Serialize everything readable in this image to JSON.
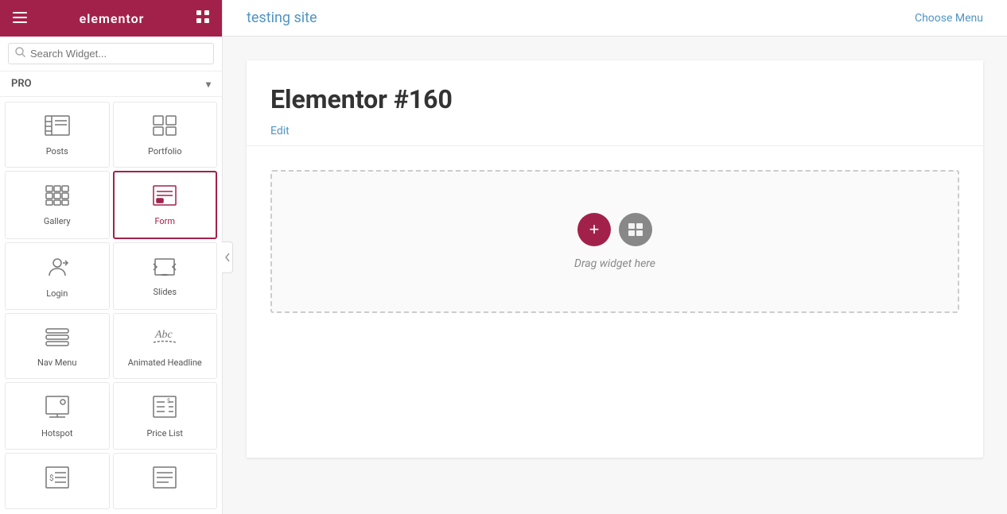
{
  "sidebar": {
    "header": {
      "brand": "elementor",
      "hamburger": "☰",
      "grid": "⊞"
    },
    "search": {
      "placeholder": "Search Widget..."
    },
    "pro_filter": {
      "label": "PRO",
      "chevron": "▾"
    },
    "widgets": [
      {
        "id": "posts",
        "label": "Posts",
        "icon": "posts"
      },
      {
        "id": "portfolio",
        "label": "Portfolio",
        "icon": "portfolio"
      },
      {
        "id": "gallery",
        "label": "Gallery",
        "icon": "gallery"
      },
      {
        "id": "form",
        "label": "Form",
        "icon": "form",
        "active": true
      },
      {
        "id": "login",
        "label": "Login",
        "icon": "login"
      },
      {
        "id": "slides",
        "label": "Slides",
        "icon": "slides"
      },
      {
        "id": "nav-menu",
        "label": "Nav Menu",
        "icon": "navmenu"
      },
      {
        "id": "animated-headline",
        "label": "Animated Headline",
        "icon": "animated"
      },
      {
        "id": "hotspot",
        "label": "Hotspot",
        "icon": "hotspot"
      },
      {
        "id": "price-list",
        "label": "Price List",
        "icon": "pricelist"
      },
      {
        "id": "widget-11",
        "label": "",
        "icon": "widget11"
      },
      {
        "id": "widget-12",
        "label": "",
        "icon": "widget12"
      }
    ]
  },
  "topbar": {
    "site_title": "testing site",
    "choose_menu": "Choose Menu"
  },
  "page": {
    "title": "Elementor #160",
    "edit_label": "Edit",
    "drop_zone_label": "Drag widget here",
    "btn_add": "+",
    "btn_template": "▣"
  }
}
